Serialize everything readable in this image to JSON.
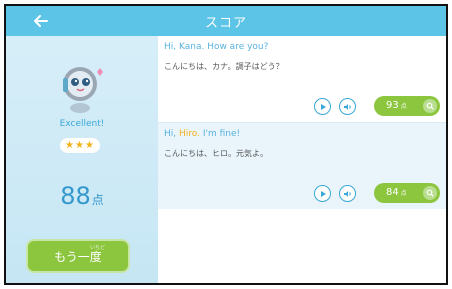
{
  "header": {
    "title": "スコア"
  },
  "sidebar": {
    "rating": "Excellent!",
    "stars": "★★★",
    "score": "88",
    "score_unit": "点",
    "retry_label": "もう一度",
    "retry_ruby": "いちど"
  },
  "messages": [
    {
      "en_prefix": "Hi, Kana. How are you?",
      "en_highlight": "",
      "en_suffix": "",
      "jp": "こんにちは、カナ。調子はどう？",
      "score": "93",
      "unit": "点"
    },
    {
      "en_prefix": "Hi, ",
      "en_highlight": "Hiro.",
      "en_suffix": " I'm fine!",
      "jp": "こんにちは、ヒロ。元気よ。",
      "score": "84",
      "unit": "点"
    }
  ],
  "colors": {
    "header": "#5cc4e6",
    "accent_blue": "#39a8d8",
    "green": "#8cc63f",
    "star": "#f1b21a"
  },
  "icons": [
    "back-arrow-icon",
    "play-icon",
    "speaker-icon",
    "magnifier-icon",
    "robot-avatar-icon"
  ]
}
